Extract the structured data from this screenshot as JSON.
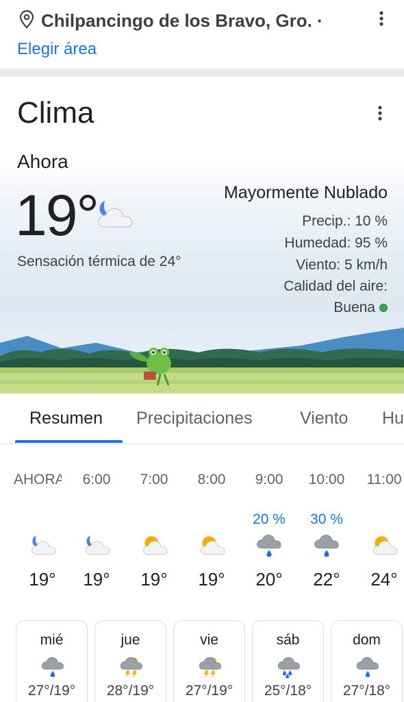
{
  "location": {
    "name": "Chilpancingo de los Bravo, Gro. ·",
    "change_area": "Elegir área"
  },
  "weather": {
    "title": "Clima",
    "now_label": "Ahora",
    "temperature": "19°",
    "current_icon": "moon-cloud-icon",
    "feels_like": "Sensación térmica de 24°",
    "condition": "Mayormente Nublado",
    "precip": "Precip.: 10 %",
    "humidity": "Humedad: 95 %",
    "wind": "Viento: 5 km/h",
    "air_quality_label": "Calidad del aire:",
    "air_quality_value": "Buena",
    "air_quality_color": "#34a853"
  },
  "tabs": [
    "Resumen",
    "Precipitaciones",
    "Viento",
    "Hu"
  ],
  "hourly": [
    {
      "time": "AHORA",
      "precip": "",
      "icon": "moon-cloud-icon",
      "temp": "19°"
    },
    {
      "time": "6:00",
      "precip": "",
      "icon": "moon-cloud-icon",
      "temp": "19°"
    },
    {
      "time": "7:00",
      "precip": "",
      "icon": "sun-cloud-icon",
      "temp": "19°"
    },
    {
      "time": "8:00",
      "precip": "",
      "icon": "sun-cloud-icon",
      "temp": "19°"
    },
    {
      "time": "9:00",
      "precip": "20 %",
      "icon": "rain-cloud-icon",
      "temp": "20°"
    },
    {
      "time": "10:00",
      "precip": "30 %",
      "icon": "rain-cloud-icon",
      "temp": "22°"
    },
    {
      "time": "11:00",
      "precip": "",
      "icon": "sun-cloud-icon",
      "temp": "24°"
    }
  ],
  "daily": [
    {
      "day": "mié",
      "icon": "rain-cloud-icon",
      "range": "27°/19°"
    },
    {
      "day": "jue",
      "icon": "thunderstorm-icon",
      "range": "28°/19°"
    },
    {
      "day": "vie",
      "icon": "thunderstorm-icon",
      "range": "27°/19°"
    },
    {
      "day": "sáb",
      "icon": "heavy-rain-icon",
      "range": "25°/18°"
    },
    {
      "day": "dom",
      "icon": "rain-cloud-icon",
      "range": "27°/18°"
    }
  ],
  "colors": {
    "accent": "#1a73e8",
    "precip_text": "#1a73e8"
  }
}
